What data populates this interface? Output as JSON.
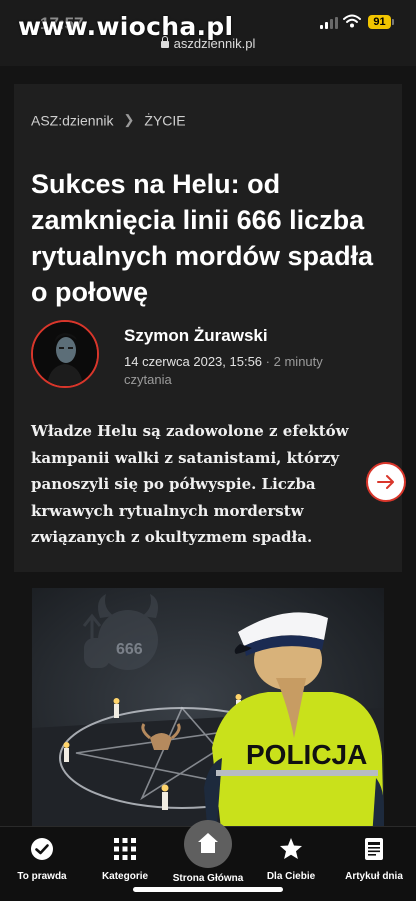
{
  "status": {
    "time": "17:57",
    "url": "aszdziennik.pl",
    "battery": "91",
    "watermark": "www.wiocha.pl"
  },
  "breadcrumb": {
    "site": "ASZ:dziennik",
    "section": "ŻYCIE"
  },
  "article": {
    "title": "Sukces na Helu: od zamknięcia linii 666 liczba rytualnych mordów spadła o połowę",
    "author": "Szymon Żurawski",
    "date": "14 czerwca 2023, 15:56",
    "separator": "·",
    "read_time": "2 minuty czytania",
    "lead": "Władze Helu są zadowolone z efektów kampanii walki z satanistami, którzy panoszyli się po półwyspie. Liczba krwawych rytualnych morderstw związanych z okultyzmem spadła.",
    "image_badge_text": "666",
    "image_vest_text": "POLICJA"
  },
  "bottom_nav": {
    "items": [
      {
        "label": "To prawda",
        "icon": "check-circle-icon"
      },
      {
        "label": "Kategorie",
        "icon": "grid-icon"
      },
      {
        "label": "Strona Główna",
        "icon": "home-icon"
      },
      {
        "label": "Dla Ciebie",
        "icon": "star-icon"
      },
      {
        "label": "Artykuł dnia",
        "icon": "newspaper-icon"
      }
    ]
  },
  "colors": {
    "accent": "#d9362b",
    "background": "#141414",
    "card": "#1f1f1f",
    "battery": "#f2c500",
    "vest": "#cde61c"
  }
}
